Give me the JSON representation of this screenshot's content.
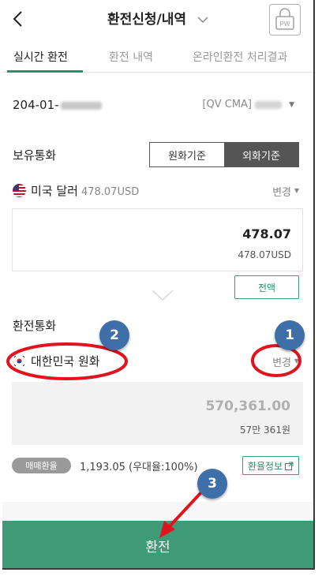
{
  "header": {
    "title": "환전신청/내역",
    "pw_label": "PW"
  },
  "tabs": [
    {
      "label": "실시간 환전",
      "active": true
    },
    {
      "label": "환전 내역",
      "active": false
    },
    {
      "label": "온라인환전 처리결과",
      "active": false
    }
  ],
  "account": {
    "number_prefix": "204-01-",
    "type_label": "[QV CMA]"
  },
  "holdings": {
    "label": "보유통화",
    "toggle": {
      "left": "원화기준",
      "right": "외화기준",
      "selected": "외화기준"
    },
    "currency_name": "미국 달러",
    "currency_amount": "478.07USD",
    "change_label": "변경",
    "amount_main": "478.07",
    "amount_sub": "478.07USD",
    "all_button": "전액"
  },
  "target": {
    "label": "환전통화",
    "currency_name": "대한민국 원화",
    "change_label": "변경",
    "amount_main": "570,361.00",
    "amount_sub": "57만 361원"
  },
  "rate": {
    "badge": "매매환율",
    "value_text": "1,193.05 (우대율:100%)",
    "info_button": "환율정보"
  },
  "submit_label": "환전",
  "annotations": {
    "badge_1": "1",
    "badge_2": "2",
    "badge_3": "3",
    "color_red": "#e0141e",
    "color_badge": "#3f6fa8",
    "color_accent": "#3e9a77"
  }
}
